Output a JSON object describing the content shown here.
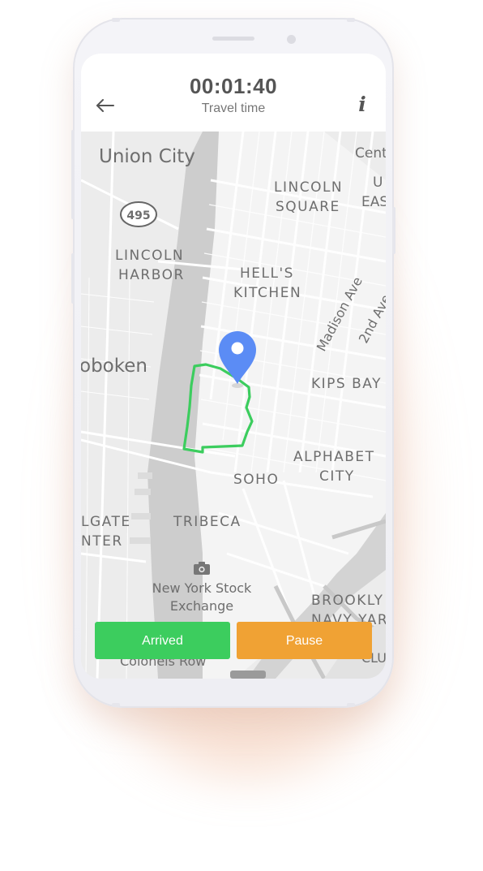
{
  "header": {
    "timer": "00:01:40",
    "subtitle": "Travel time",
    "back_icon": "arrow-left-icon",
    "info_icon": "info-icon"
  },
  "map": {
    "labels": {
      "union_city": "Union City",
      "lincoln_harbor_1": "LINCOLN",
      "lincoln_harbor_2": "HARBOR",
      "lincoln_square_1": "LINCOLN",
      "lincoln_square_2": "SQUARE",
      "hells_kitchen_1": "HELL'S",
      "hells_kitchen_2": "KITCHEN",
      "madison_ave": "Madison Ave",
      "second_ave": "2nd Ave",
      "hoboken": "oboken",
      "kips_bay": "KIPS BAY",
      "alphabet_city_1": "ALPHABET",
      "alphabet_city_2": "CITY",
      "soho": "SOHO",
      "colgate_1": "LGATE",
      "colgate_2": "NTER",
      "tribeca": "TRIBECA",
      "nyse_1": "New York Stock",
      "nyse_2": "Exchange",
      "brooklyn_navy_1": "BROOKLY",
      "brooklyn_navy_2": "NAVY YAR",
      "colonels_row": "Colonels Row",
      "central": "Cent",
      "upper_east_1": "U",
      "upper_east_2": "EAS",
      "route_495": "495",
      "clu": "CLU"
    },
    "marker_icon": "location-pin-icon",
    "camera_icon": "camera-icon",
    "route_color": "#3ccd5e",
    "marker_color": "#5b8cf5"
  },
  "actions": {
    "arrived_label": "Arrived",
    "pause_label": "Pause",
    "arrived_color": "#3ccd5e",
    "pause_color": "#f0a234"
  }
}
